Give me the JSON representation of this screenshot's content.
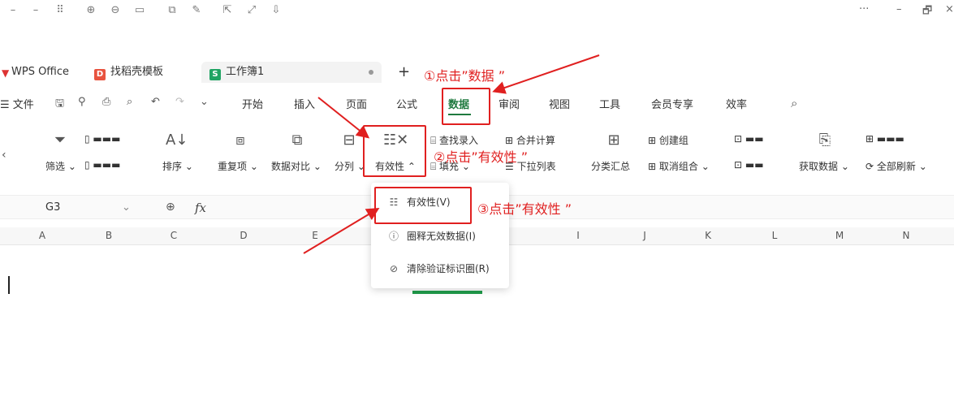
{
  "window": {
    "controls": [
      "···",
      "–",
      "🗗",
      "×"
    ]
  },
  "tabs": [
    {
      "label": "WPS Office",
      "logo": "wps-logo"
    },
    {
      "label": "找稻壳模板",
      "logo": "docer-logo"
    },
    {
      "label": "工作簿1",
      "logo": "S"
    }
  ],
  "new_tab": "+",
  "menu": {
    "file": "文件",
    "items": [
      "开始",
      "插入",
      "页面",
      "公式",
      "数据",
      "审阅",
      "视图",
      "工具",
      "会员专享",
      "效率"
    ],
    "active": "数据"
  },
  "ribbon": {
    "filter": "筛选",
    "sort": "排序",
    "duplicates": "重复项",
    "compare": "数据对比",
    "split": "分列",
    "validity": "有效性",
    "lookup_entry": "查找录入",
    "fill": "填充",
    "merge_calc": "合并计算",
    "dropdown_list": "下拉列表",
    "subtotal": "分类汇总",
    "create_group": "创建组",
    "ungroup": "取消组合",
    "get_data": "获取数据",
    "refresh_all": "全部刷新"
  },
  "formula_bar": {
    "cell_ref": "G3",
    "fx": "fx"
  },
  "columns": [
    "A",
    "B",
    "C",
    "D",
    "E",
    "I",
    "J",
    "K",
    "L",
    "M",
    "N"
  ],
  "dropdown": [
    {
      "label": "有效性(V)",
      "icon": "validity-icon"
    },
    {
      "label": "圈释无效数据(I)",
      "icon": "circle-info-icon"
    },
    {
      "label": "清除验证标识圈(R)",
      "icon": "clear-circle-icon"
    }
  ],
  "annotations": {
    "step1": "①点击”数据 ”",
    "step2": "②点击”有效性 ”",
    "step3": "③点击”有效性 ”"
  },
  "colors": {
    "annotation_red": "#e02020",
    "wps_green": "#1f7a3f"
  }
}
